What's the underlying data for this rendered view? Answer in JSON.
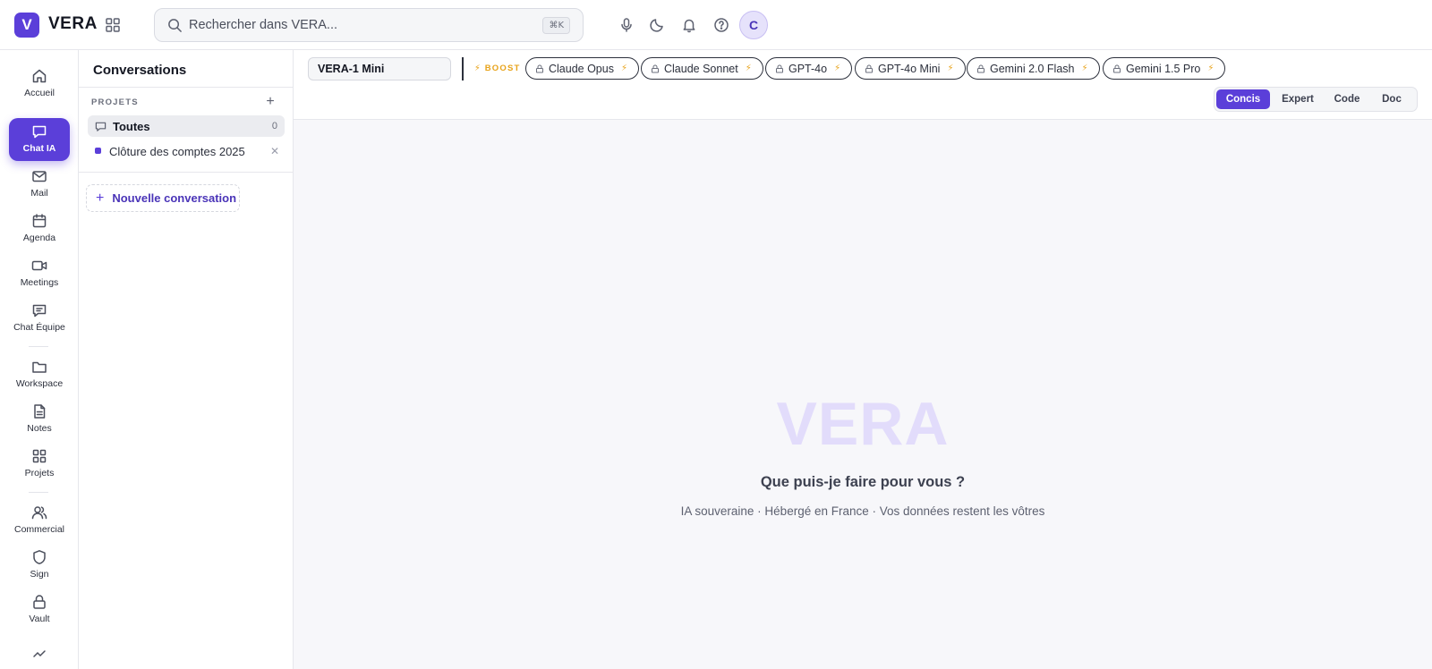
{
  "app": {
    "logo_letter": "V",
    "name": "VERA"
  },
  "search": {
    "placeholder": "Rechercher dans VERA...",
    "shortcut": "⌘K"
  },
  "user": {
    "avatar_initial": "C"
  },
  "rail": {
    "items": [
      {
        "label": "Accueil",
        "icon": "home-icon"
      },
      {
        "label": "Chat IA",
        "icon": "chat-icon",
        "active": true
      },
      {
        "label": "Mail",
        "icon": "mail-icon"
      },
      {
        "label": "Agenda",
        "icon": "calendar-icon"
      },
      {
        "label": "Meetings",
        "icon": "video-icon"
      },
      {
        "label": "Chat Équipe",
        "icon": "team-chat-icon"
      },
      {
        "label": "Workspace",
        "icon": "folder-icon"
      },
      {
        "label": "Notes",
        "icon": "note-icon"
      },
      {
        "label": "Projets",
        "icon": "grid-icon"
      },
      {
        "label": "Commercial",
        "icon": "users-icon"
      },
      {
        "label": "Sign",
        "icon": "shield-icon"
      },
      {
        "label": "Vault",
        "icon": "lock-icon"
      }
    ]
  },
  "conversations": {
    "title": "Conversations",
    "projects_label": "PROJETS",
    "all": {
      "label": "Toutes",
      "count": "0"
    },
    "projects": [
      {
        "label": "Clôture des comptes 2025",
        "color": "#5b3fd9"
      }
    ],
    "new_button": "Nouvelle conversation"
  },
  "toolbar": {
    "model": "VERA-1 Mini",
    "boost_label": "⚡ BOOST",
    "chips": [
      "Claude Opus",
      "Claude Sonnet",
      "GPT-4o",
      "GPT-4o Mini",
      "Gemini 2.0 Flash",
      "Gemini 1.5 Pro"
    ],
    "modes": [
      {
        "label": "Concis",
        "active": true
      },
      {
        "label": "Expert"
      },
      {
        "label": "Code"
      },
      {
        "label": "Doc"
      }
    ]
  },
  "hero": {
    "logo": "VERA",
    "question": "Que puis-je faire pour vous ?",
    "subtitle": "IA souveraine · Hébergé en France · Vos données restent les vôtres"
  },
  "colors": {
    "accent": "#5b3fd9",
    "boost": "#e8a31a",
    "hero_logo": "#e2dcfb"
  }
}
